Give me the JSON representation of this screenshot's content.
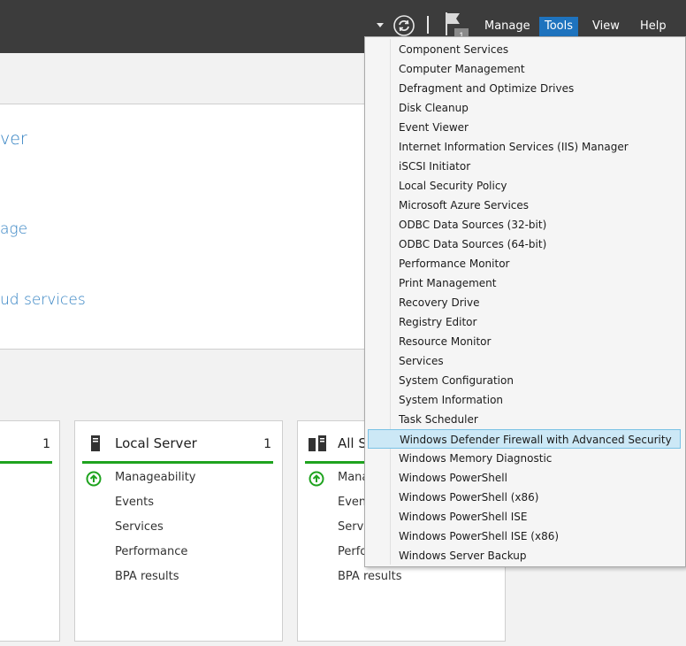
{
  "header": {
    "menus": [
      {
        "label": "Manage"
      },
      {
        "label": "Tools",
        "active": true
      },
      {
        "label": "View"
      },
      {
        "label": "Help"
      }
    ],
    "notification_count": "1",
    "icons": [
      "chevron-down-icon",
      "refresh-icon",
      "flag-icon"
    ]
  },
  "background": {
    "text_fragments": [
      "ver",
      "age",
      "ud services"
    ]
  },
  "tiles": [
    {
      "count": "1"
    },
    {
      "title": "Local Server",
      "count": "1",
      "items": [
        "Manageability",
        "Events",
        "Services",
        "Performance",
        "BPA results"
      ]
    },
    {
      "title": "All S",
      "items": [
        "Mana",
        "Event",
        "Servi",
        "Perfo",
        "BPA results"
      ]
    }
  ],
  "tools_menu": {
    "items": [
      "Component Services",
      "Computer Management",
      "Defragment and Optimize Drives",
      "Disk Cleanup",
      "Event Viewer",
      "Internet Information Services (IIS) Manager",
      "iSCSI Initiator",
      "Local Security Policy",
      "Microsoft Azure Services",
      "ODBC Data Sources (32-bit)",
      "ODBC Data Sources (64-bit)",
      "Performance Monitor",
      "Print Management",
      "Recovery Drive",
      "Registry Editor",
      "Resource Monitor",
      "Services",
      "System Configuration",
      "System Information",
      "Task Scheduler",
      "Windows Defender Firewall with Advanced Security",
      "Windows Memory Diagnostic",
      "Windows PowerShell",
      "Windows PowerShell (x86)",
      "Windows PowerShell ISE",
      "Windows PowerShell ISE (x86)",
      "Windows Server Backup"
    ],
    "highlighted_index": 20
  },
  "colors": {
    "topbar": "#3c3c3c",
    "accent": "#1e73be",
    "link": "#2f7fc1",
    "status_green": "#1fa31f",
    "highlight": "#cce8f6"
  }
}
